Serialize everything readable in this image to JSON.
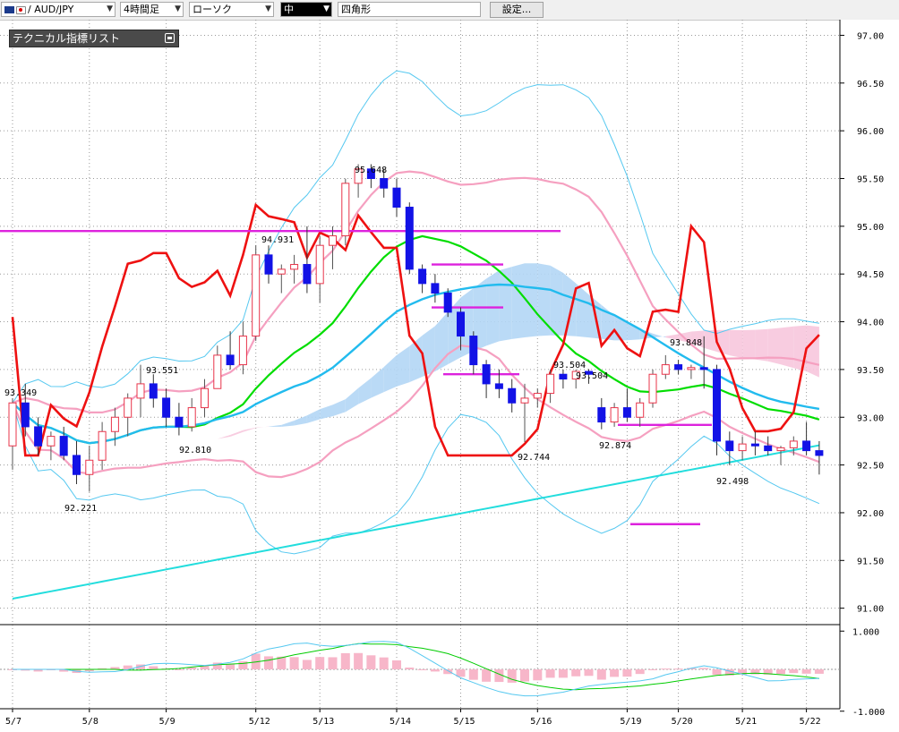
{
  "toolbar": {
    "pair": "/ AUD/JPY",
    "timeframe": "4時間足",
    "chart_type": "ローソク",
    "line_width": "中",
    "marker_shape": "四角形",
    "settings_label": "設定..."
  },
  "legend": {
    "title": "テクニカル指標リスト"
  },
  "colors": {
    "bull_body": "#ffffff",
    "bull_border": "#e8344a",
    "bear": "#1212e6",
    "bollinger": "#55c8f0",
    "bollinger_mid": "#f5a0c0",
    "ema": "#00dd00",
    "sma_long": "#22dddd",
    "rsi": "#ee1111",
    "hline": "#dd22dd",
    "cloud_bull": "#b3d6f5",
    "cloud_bear": "#f7c6dd"
  },
  "chart_data": {
    "type": "candlestick",
    "ylim": [
      90.5,
      97.25
    ],
    "y_ticks": [
      "91.00",
      "91.50",
      "92.00",
      "92.50",
      "93.00",
      "93.50",
      "94.00",
      "94.50",
      "95.00",
      "95.50",
      "96.00",
      "96.50",
      "97.00"
    ],
    "x_ticks": [
      "5/7",
      "5/8",
      "5/9",
      "5/12",
      "5/13",
      "5/14",
      "5/15",
      "5/16",
      "5/19",
      "5/20",
      "5/21",
      "5/22"
    ],
    "price_labels": [
      "93.349",
      "92.221",
      "93.551",
      "92.810",
      "94.931",
      "95.648",
      "93.504",
      "93.504",
      "92.744",
      "92.874",
      "93.848",
      "92.498"
    ],
    "horizontal_levels": [
      94.95,
      94.6,
      94.15,
      93.45,
      92.92,
      91.88
    ],
    "candles": [
      [
        92.7,
        93.2,
        92.45,
        93.15
      ],
      [
        93.15,
        93.35,
        92.8,
        92.9
      ],
      [
        92.9,
        93.0,
        92.6,
        92.7
      ],
      [
        92.7,
        92.85,
        92.55,
        92.8
      ],
      [
        92.8,
        92.9,
        92.55,
        92.6
      ],
      [
        92.6,
        92.75,
        92.3,
        92.4
      ],
      [
        92.4,
        92.7,
        92.22,
        92.55
      ],
      [
        92.55,
        92.95,
        92.45,
        92.85
      ],
      [
        92.85,
        93.1,
        92.7,
        93.0
      ],
      [
        93.0,
        93.25,
        92.8,
        93.2
      ],
      [
        93.2,
        93.55,
        93.0,
        93.35
      ],
      [
        93.35,
        93.45,
        93.1,
        93.2
      ],
      [
        93.2,
        93.3,
        92.9,
        93.0
      ],
      [
        93.0,
        93.15,
        92.81,
        92.9
      ],
      [
        92.9,
        93.2,
        92.85,
        93.1
      ],
      [
        93.1,
        93.4,
        93.0,
        93.3
      ],
      [
        93.3,
        93.75,
        93.6,
        93.65
      ],
      [
        93.65,
        93.9,
        93.5,
        93.55
      ],
      [
        93.55,
        94.0,
        93.45,
        93.85
      ],
      [
        93.85,
        94.8,
        93.8,
        94.7
      ],
      [
        94.7,
        94.8,
        94.4,
        94.5
      ],
      [
        94.5,
        94.6,
        94.3,
        94.55
      ],
      [
        94.55,
        94.7,
        94.4,
        94.6
      ],
      [
        94.6,
        95.0,
        94.3,
        94.4
      ],
      [
        94.4,
        94.9,
        94.2,
        94.8
      ],
      [
        94.8,
        95.0,
        94.55,
        94.9
      ],
      [
        94.9,
        95.5,
        94.8,
        95.45
      ],
      [
        95.45,
        95.65,
        95.3,
        95.6
      ],
      [
        95.6,
        95.65,
        95.4,
        95.5
      ],
      [
        95.5,
        95.6,
        95.3,
        95.4
      ],
      [
        95.4,
        95.5,
        95.1,
        95.2
      ],
      [
        95.2,
        95.25,
        94.5,
        94.55
      ],
      [
        94.55,
        94.6,
        94.3,
        94.4
      ],
      [
        94.4,
        94.5,
        94.2,
        94.3
      ],
      [
        94.3,
        94.35,
        94.05,
        94.1
      ],
      [
        94.1,
        94.15,
        93.7,
        93.85
      ],
      [
        93.85,
        93.9,
        93.45,
        93.55
      ],
      [
        93.55,
        93.6,
        93.2,
        93.35
      ],
      [
        93.35,
        93.5,
        93.2,
        93.3
      ],
      [
        93.3,
        93.4,
        93.05,
        93.15
      ],
      [
        93.15,
        93.35,
        92.74,
        93.2
      ],
      [
        93.2,
        93.3,
        93.1,
        93.25
      ],
      [
        93.25,
        93.5,
        93.15,
        93.45
      ],
      [
        93.45,
        93.5,
        93.3,
        93.4
      ],
      [
        93.4,
        93.5,
        93.3,
        93.48
      ],
      [
        93.48,
        93.504,
        93.35,
        93.45
      ],
      [
        93.1,
        93.2,
        92.874,
        92.95
      ],
      [
        92.95,
        93.15,
        92.9,
        93.1
      ],
      [
        93.1,
        93.3,
        92.95,
        93.0
      ],
      [
        93.0,
        93.2,
        92.9,
        93.15
      ],
      [
        93.15,
        93.5,
        93.1,
        93.45
      ],
      [
        93.45,
        93.65,
        93.4,
        93.55
      ],
      [
        93.55,
        93.6,
        93.45,
        93.5
      ],
      [
        93.5,
        93.55,
        93.4,
        93.52
      ],
      [
        93.52,
        93.848,
        93.3,
        93.5
      ],
      [
        93.5,
        93.55,
        92.6,
        92.75
      ],
      [
        92.75,
        92.85,
        92.498,
        92.65
      ],
      [
        92.65,
        92.8,
        92.55,
        92.72
      ],
      [
        92.72,
        92.85,
        92.6,
        92.7
      ],
      [
        92.7,
        92.8,
        92.6,
        92.65
      ],
      [
        92.65,
        92.7,
        92.5,
        92.68
      ],
      [
        92.68,
        92.8,
        92.6,
        92.75
      ],
      [
        92.75,
        92.95,
        92.6,
        92.65
      ],
      [
        92.65,
        92.75,
        92.4,
        92.6
      ]
    ],
    "oscillator": {
      "ylim": [
        -1.0,
        1.0
      ],
      "y_ticks": [
        "1.000",
        "-1.000"
      ]
    }
  }
}
